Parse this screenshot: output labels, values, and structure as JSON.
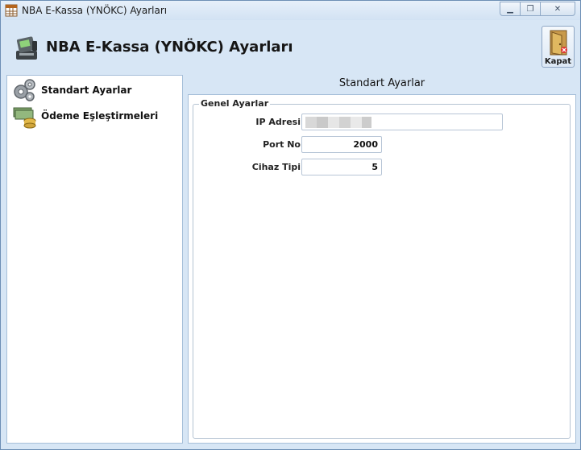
{
  "window": {
    "title": "NBA E-Kassa (YNÖKC) Ayarları",
    "controls": {
      "minimize": "▁",
      "restore": "❐",
      "close": "✕"
    }
  },
  "header": {
    "title": "NBA E-Kassa (YNÖKC) Ayarları",
    "icon": "cash-register-icon",
    "close_button": {
      "label": "Kapat",
      "icon": "exit-door-icon"
    }
  },
  "sidebar": {
    "items": [
      {
        "label": "Standart Ayarlar",
        "icon": "gears-icon"
      },
      {
        "label": "Ödeme Eşleştirmeleri",
        "icon": "money-coins-icon"
      }
    ]
  },
  "content": {
    "title": "Standart Ayarlar",
    "group": {
      "label": "Genel Ayarlar",
      "fields": {
        "ip": {
          "label": "IP Adresi",
          "value": ""
        },
        "port": {
          "label": "Port No",
          "value": "2000"
        },
        "device": {
          "label": "Cihaz Tipi",
          "value": "5"
        }
      }
    }
  },
  "colors": {
    "window_bg": "#d7e6f5",
    "panel_border": "#a6bfd9"
  }
}
